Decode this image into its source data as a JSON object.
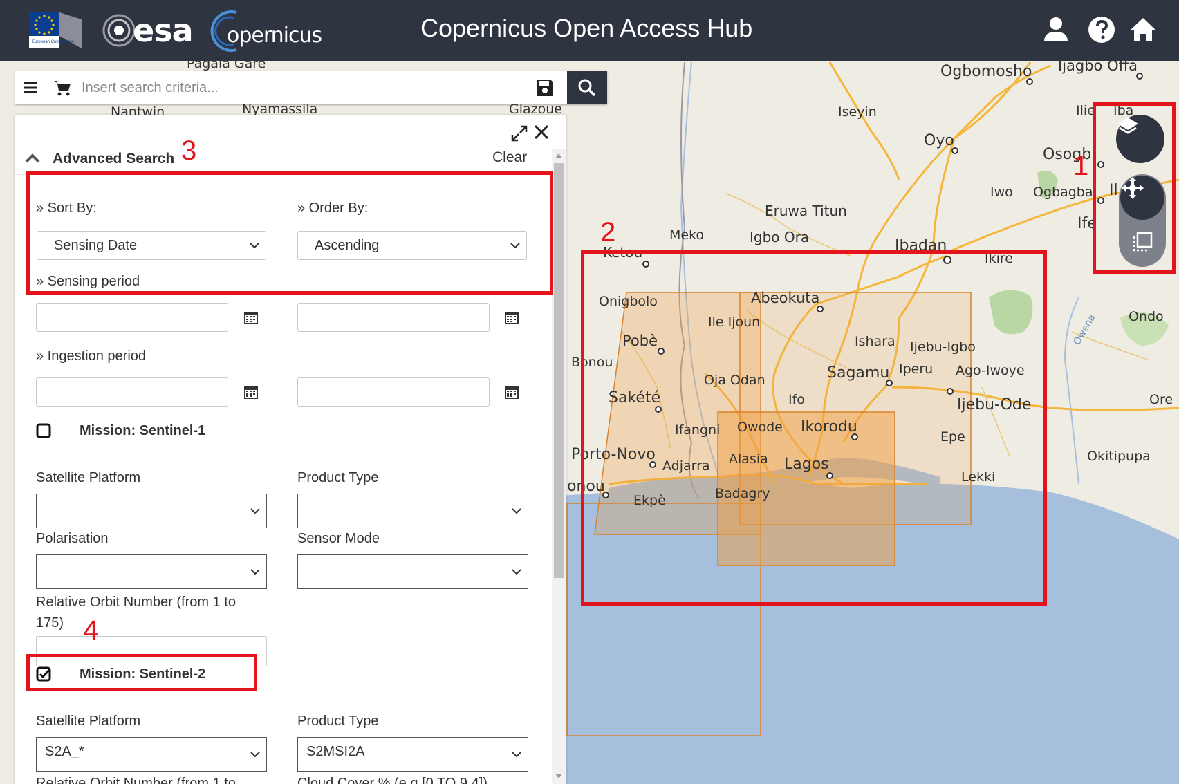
{
  "header": {
    "title": "Copernicus Open Access Hub",
    "logos": {
      "ec": "European Commission",
      "esa": "esa",
      "copernicus": "opernicus"
    }
  },
  "search": {
    "placeholder": "Insert search criteria..."
  },
  "panel": {
    "title": "Advanced Search",
    "clear": "Clear",
    "sort_by_label": "» Sort By:",
    "sort_by_value": "Sensing Date",
    "order_by_label": "» Order By:",
    "order_by_value": "Ascending",
    "sensing_period_label": "» Sensing period",
    "ingestion_period_label": "» Ingestion period",
    "s1": {
      "title": "Mission: Sentinel-1",
      "checked": false,
      "platform_label": "Satellite Platform",
      "product_type_label": "Product Type",
      "polarisation_label": "Polarisation",
      "sensor_mode_label": "Sensor Mode",
      "orbit_label": "Relative Orbit Number (from 1 to 175)"
    },
    "s2": {
      "title": "Mission: Sentinel-2",
      "checked": true,
      "platform_label": "Satellite Platform",
      "platform_value": "S2A_*",
      "product_type_label": "Product Type",
      "product_type_value": "S2MSI2A",
      "orbit_label": "Relative Orbit Number (from 1 to",
      "cloud_label": "Cloud Cover % (e.g.[0 TO 9.4])"
    }
  },
  "map": {
    "places": [
      {
        "name": "Pagala Gare"
      },
      {
        "name": "Nyamassila"
      },
      {
        "name": "Nantwin"
      },
      {
        "name": "Glazoue"
      },
      {
        "name": "Ogbomosho"
      },
      {
        "name": "Ijagbo Offa"
      },
      {
        "name": "Iseyin"
      },
      {
        "name": "Oyo"
      },
      {
        "name": "Osogb"
      },
      {
        "name": "Ilie"
      },
      {
        "name": "Iba"
      },
      {
        "name": "Iwo"
      },
      {
        "name": "Ogbagba"
      },
      {
        "name": "Ife"
      },
      {
        "name": "Il"
      },
      {
        "name": "Eruwa Titun"
      },
      {
        "name": "Meko"
      },
      {
        "name": "Igbo Ora"
      },
      {
        "name": "Ibadan"
      },
      {
        "name": "Ketou"
      },
      {
        "name": "Ikire"
      },
      {
        "name": "Onigbolo"
      },
      {
        "name": "Abeokuta"
      },
      {
        "name": "Ile Ijoun"
      },
      {
        "name": "Pobè"
      },
      {
        "name": "Ishara"
      },
      {
        "name": "Ijebu-Igbo"
      },
      {
        "name": "Bonou"
      },
      {
        "name": "Oja Odan"
      },
      {
        "name": "Sagamu"
      },
      {
        "name": "Iperu"
      },
      {
        "name": "Ago-Iwoye"
      },
      {
        "name": "Ondo"
      },
      {
        "name": "Sakété"
      },
      {
        "name": "Ifo"
      },
      {
        "name": "Ijebu-Ode"
      },
      {
        "name": "Ore"
      },
      {
        "name": "Ifangni"
      },
      {
        "name": "Owode"
      },
      {
        "name": "Ikorodu"
      },
      {
        "name": "Epe"
      },
      {
        "name": "Porto-Novo"
      },
      {
        "name": "Adjarra"
      },
      {
        "name": "Alasia"
      },
      {
        "name": "Lagos"
      },
      {
        "name": "Okitipupa"
      },
      {
        "name": "Lekki"
      },
      {
        "name": "onou"
      },
      {
        "name": "Ekpè"
      },
      {
        "name": "Badagry"
      },
      {
        "name": "Owena"
      }
    ]
  },
  "annotations": [
    {
      "num": "1"
    },
    {
      "num": "2"
    },
    {
      "num": "3"
    },
    {
      "num": "4"
    }
  ],
  "colors": {
    "header": "#2e3440",
    "annotation": "#e3141c",
    "footprint": "#f0a044",
    "sea": "#a5bfdd"
  }
}
